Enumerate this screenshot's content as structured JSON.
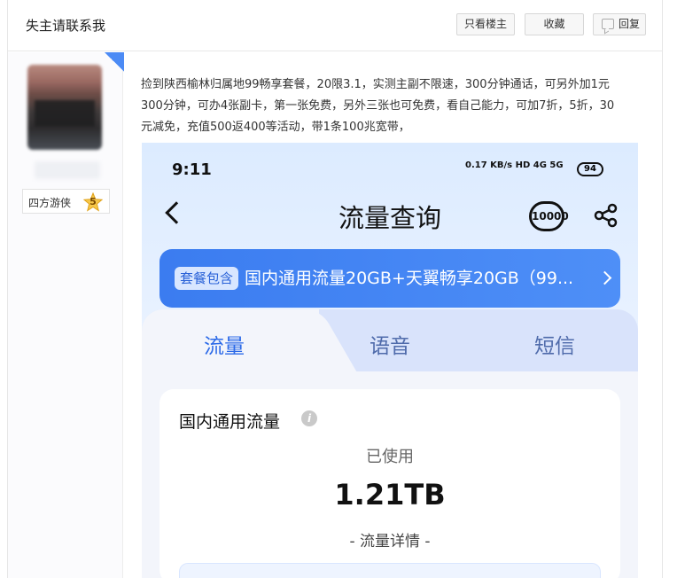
{
  "header": {
    "title": "失主请联系我",
    "only_op_label": "只看楼主",
    "favorite_label": "收藏",
    "reply_label": "回复"
  },
  "user": {
    "title_badge": "四方游侠",
    "level": "5"
  },
  "post": {
    "lines": [
      "捡到陕西榆林归属地99畅享套餐，20限3.1，实测主副不限速，300分钟通话，可另外加1元",
      "300分钟，可办4张副卡，第一张免费，另外三张也可免费，看自己能力，可加7折，5折，30",
      "元减免，充值500返400等活动，带1条100兆宽带，"
    ]
  },
  "screenshot": {
    "status_time": "9:11",
    "status_net_speed": "0.17 KB/s",
    "status_signals": "HD 4G 5G",
    "battery": "94",
    "page_title": "流量查询",
    "hotline_label": "10000",
    "banner_tag": "套餐包含",
    "banner_text": "国内通用流量20GB+天翼畅享20GB（99...",
    "tabs": [
      "流量",
      "语音",
      "短信"
    ],
    "card_title": "国内通用流量",
    "used_label": "已使用",
    "used_value": "1.21TB",
    "detail_link": "- 流量详情 -"
  },
  "colors": {
    "accent": "#2c6ae8",
    "banner": "#3b7cf0"
  }
}
